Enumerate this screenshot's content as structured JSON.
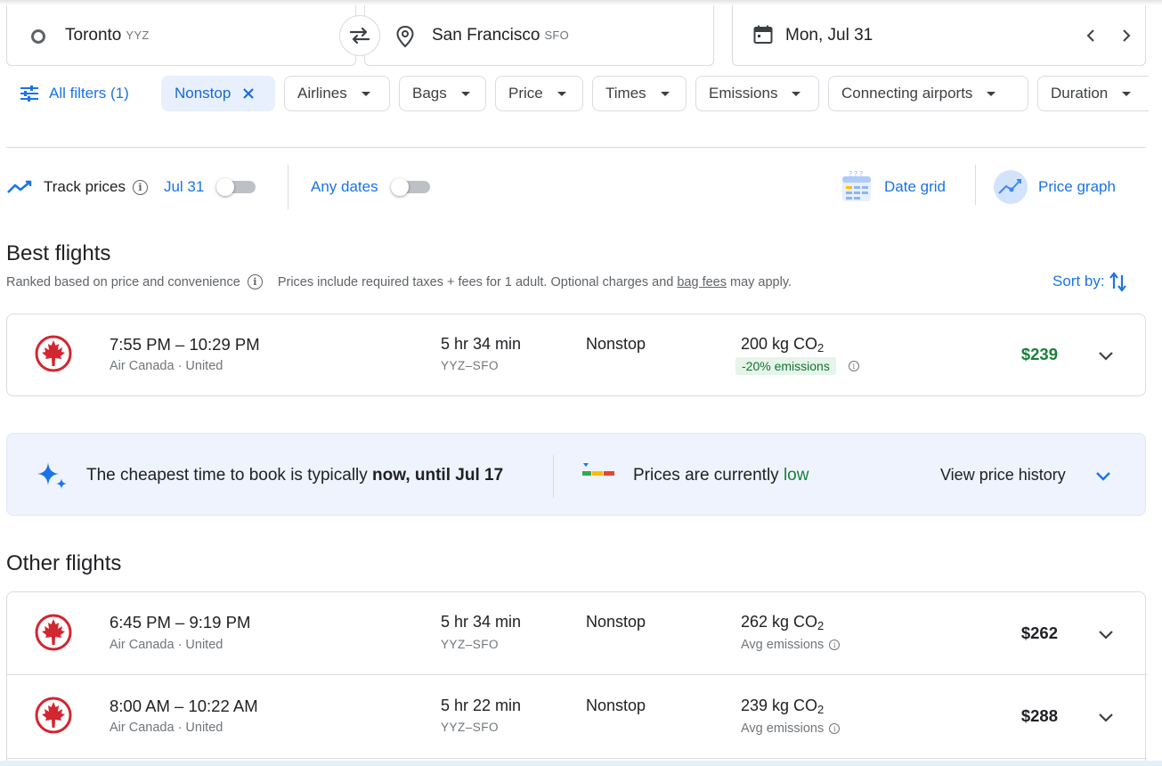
{
  "search": {
    "origin_city": "Toronto",
    "origin_code": "YYZ",
    "dest_city": "San Francisco",
    "dest_code": "SFO",
    "date": "Mon, Jul 31"
  },
  "filters": {
    "all_filters": "All filters (1)",
    "active_chip": "Nonstop",
    "chips": [
      "Airlines",
      "Bags",
      "Price",
      "Times",
      "Emissions",
      "Connecting airports",
      "Duration"
    ]
  },
  "tracking": {
    "track_label": "Track prices",
    "date_label": "Jul 31",
    "any_dates": "Any dates",
    "date_grid": "Date grid",
    "price_graph": "Price graph"
  },
  "best": {
    "title": "Best flights",
    "ranked": "Ranked based on price and convenience",
    "prices_note_a": "Prices include required taxes + fees for 1 adult. Optional charges and",
    "bag_fees": "bag fees",
    "prices_note_b": "may apply.",
    "sort_by": "Sort by:",
    "flights": [
      {
        "times": "7:55 PM – 10:29 PM",
        "airlines": "Air Canada · United",
        "duration": "5 hr 34 min",
        "route": "YYZ–SFO",
        "stops": "Nonstop",
        "co2": "200 kg CO",
        "co2_sub": "2",
        "emissions": "-20% emissions",
        "price": "$239"
      }
    ]
  },
  "insight": {
    "cheapest_a": "The cheapest time to book is typically",
    "cheapest_b": "now, until Jul 17",
    "level_a": "Prices are currently",
    "level_b": "low",
    "history": "View price history"
  },
  "other": {
    "title": "Other flights",
    "flights": [
      {
        "times": "6:45 PM – 9:19 PM",
        "airlines": "Air Canada · United",
        "duration": "5 hr 34 min",
        "route": "YYZ–SFO",
        "stops": "Nonstop",
        "co2": "262 kg CO",
        "co2_sub": "2",
        "emissions": "Avg emissions",
        "price": "$262"
      },
      {
        "times": "8:00 AM – 10:22 AM",
        "airlines": "Air Canada · United",
        "duration": "5 hr 22 min",
        "route": "YYZ–SFO",
        "stops": "Nonstop",
        "co2": "239 kg CO",
        "co2_sub": "2",
        "emissions": "Avg emissions",
        "price": "$288"
      }
    ]
  },
  "colors": {
    "accent": "#1a73e8",
    "price_green": "#188038",
    "logo_red": "#d22630"
  }
}
